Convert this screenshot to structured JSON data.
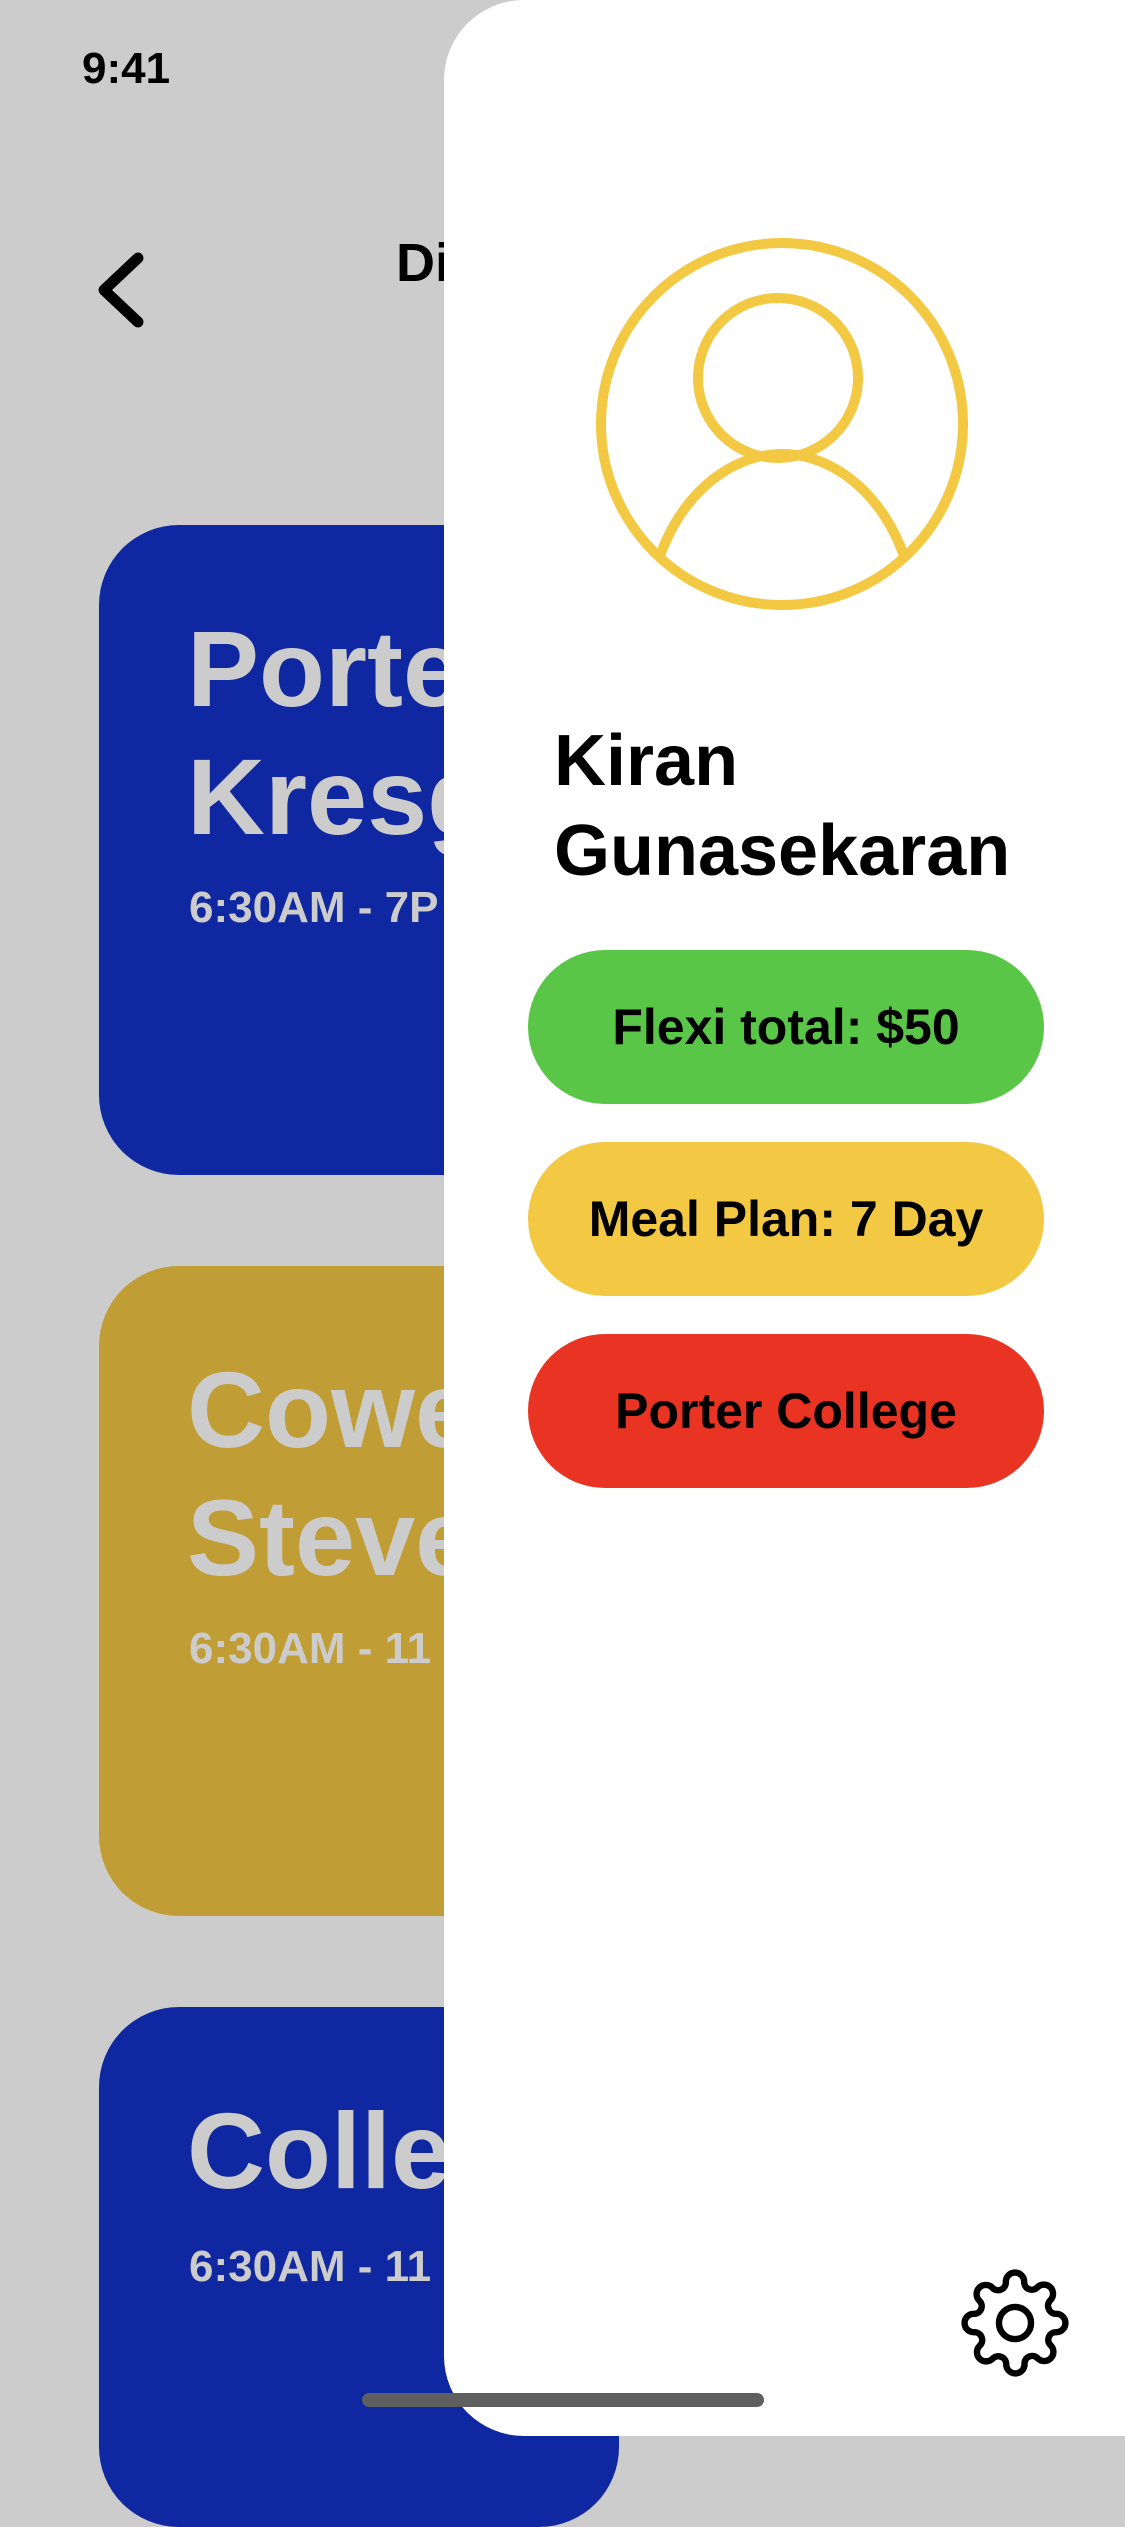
{
  "status_bar": {
    "time": "9:41"
  },
  "header": {
    "title_visible": "Di",
    "back_icon": "chevron-left-icon"
  },
  "cards": [
    {
      "title_line1": "Porte",
      "title_line2": "Kresg",
      "hours": "6:30AM - 7P",
      "color": "#0f27a0"
    },
    {
      "title_line1": "Cowe",
      "title_line2": "Steve",
      "hours": "6:30AM - 11",
      "color": "#c19e35"
    },
    {
      "title_line1": "Colle",
      "hours": "6:30AM - 11",
      "color": "#0f27a0"
    }
  ],
  "drawer": {
    "avatar_icon": "user-avatar-icon",
    "user": {
      "first_name": "Kiran",
      "last_name": "Gunasekaran"
    },
    "pills": [
      {
        "label": "Flexi total: $50",
        "color": "#5ac647"
      },
      {
        "label": "Meal Plan: 7 Day",
        "color": "#f3c943"
      },
      {
        "label": "Porter College",
        "color": "#e93424"
      }
    ],
    "settings_icon": "gear-icon"
  },
  "colors": {
    "background": "#cccccc",
    "drawer": "#ffffff",
    "avatar_stroke": "#f3c943"
  }
}
